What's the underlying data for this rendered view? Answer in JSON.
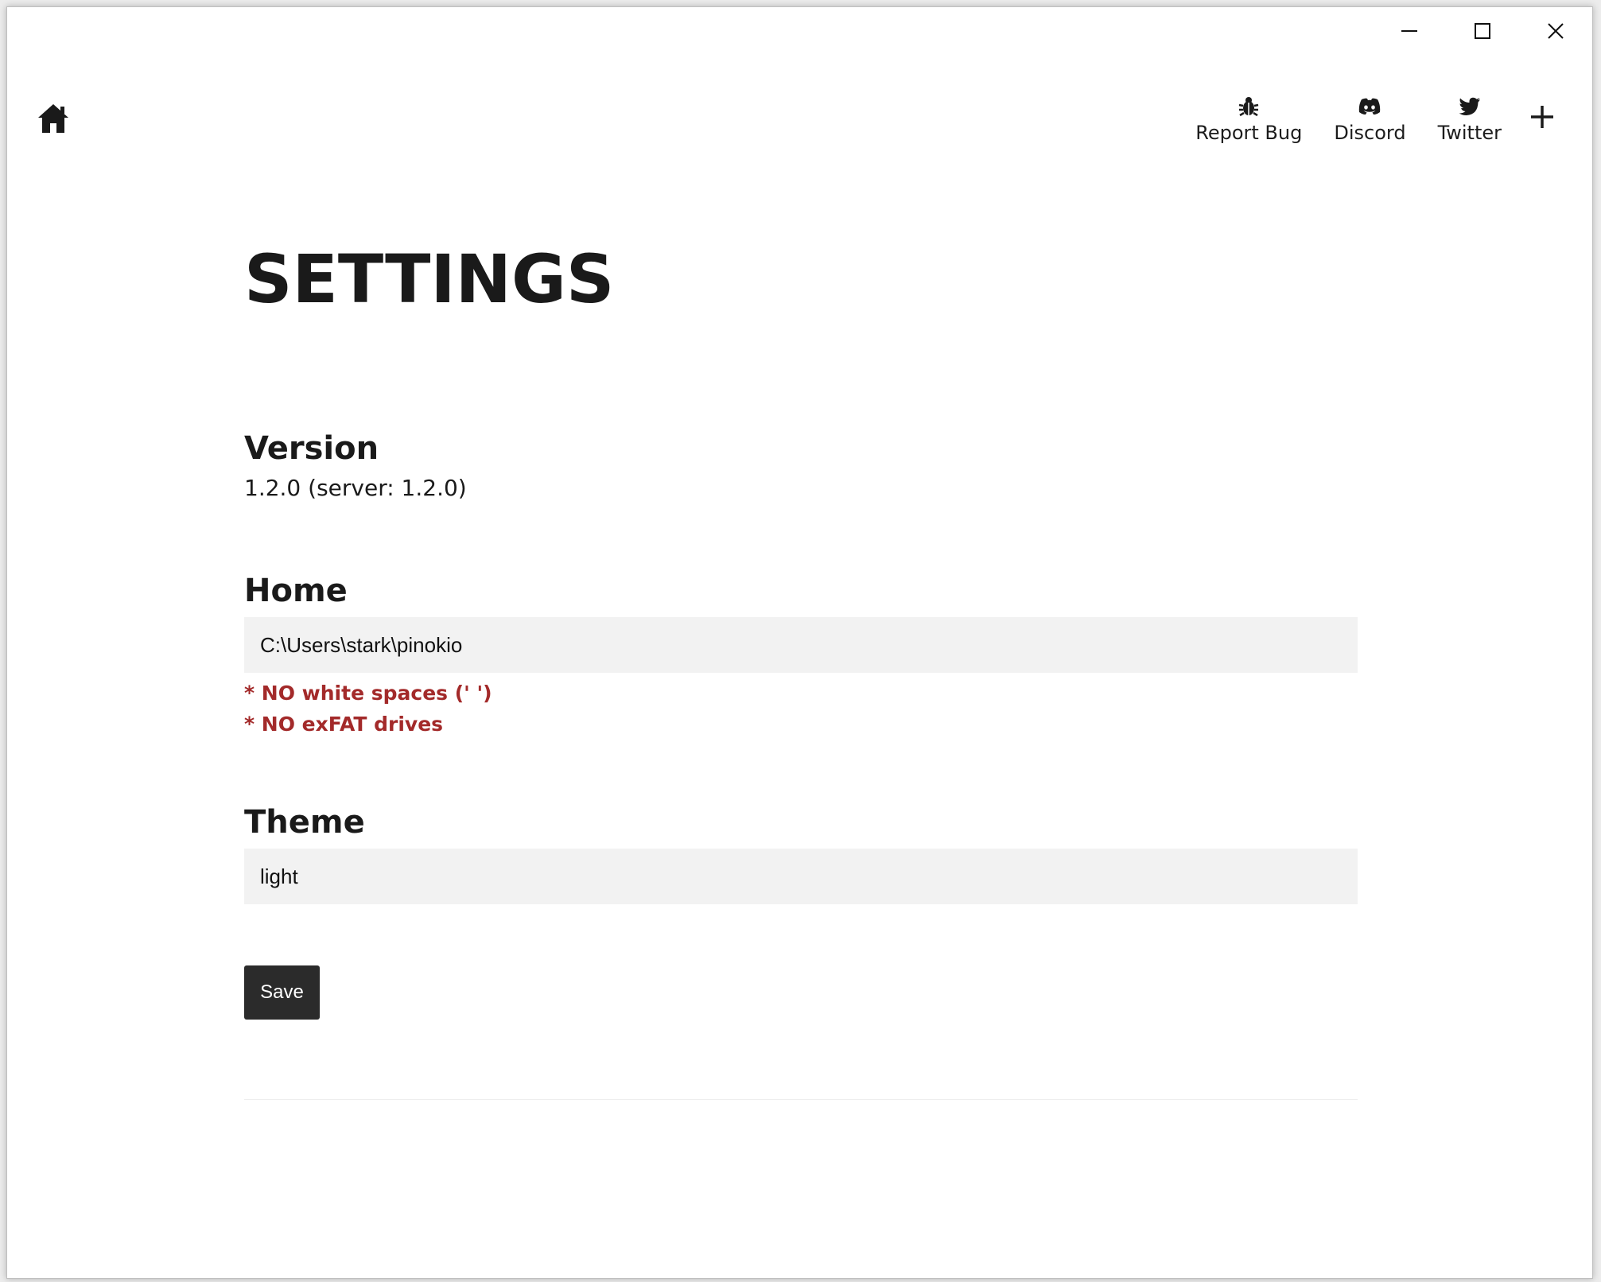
{
  "window": {
    "controls": [
      "minimize-icon",
      "maximize-icon",
      "close-icon"
    ]
  },
  "navbar": {
    "home_icon": "home-icon",
    "links": [
      {
        "label": "Report Bug",
        "icon": "bug-icon"
      },
      {
        "label": "Discord",
        "icon": "discord-icon"
      },
      {
        "label": "Twitter",
        "icon": "twitter-icon"
      }
    ],
    "plus_icon": "plus-icon"
  },
  "page": {
    "title": "SETTINGS",
    "version": {
      "title": "Version",
      "value": "1.2.0 (server: 1.2.0)"
    },
    "home": {
      "title": "Home",
      "value": "C:\\Users\\stark\\pinokio",
      "warnings": [
        "* NO white spaces (' ')",
        "* NO exFAT drives"
      ]
    },
    "theme": {
      "title": "Theme",
      "value": "light"
    },
    "save_label": "Save"
  },
  "colors": {
    "warning": "#a32a2a",
    "save_button_bg": "#2b2b2b",
    "field_bg": "#f2f2f2"
  }
}
